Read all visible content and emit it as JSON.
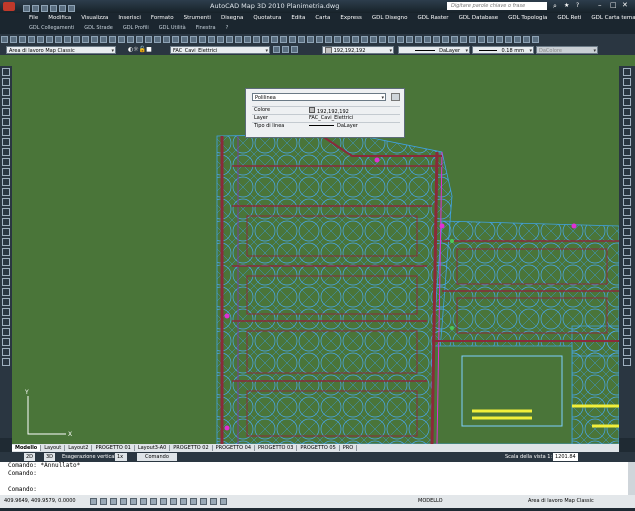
{
  "titlebar": {
    "title": "AutoCAD Map 3D 2010   Planimetria.dwg",
    "search_placeholder": "Digitare parole chiave o frase"
  },
  "menu": {
    "row1": [
      "File",
      "Modifica",
      "Visualizza",
      "Inserisci",
      "Formato",
      "Strumenti",
      "Disegna",
      "Quotatura",
      "Edita",
      "Carta",
      "Express",
      "GDL Disegno",
      "GDL Raster",
      "GDL Database",
      "GDL Topologia",
      "GDL Reti",
      "GDL Carta tematica"
    ],
    "row2": [
      "GDL Collegamenti",
      "GDL Strade",
      "GDL Profili",
      "GDL Utilità",
      "Finestra",
      "?"
    ]
  },
  "toolbar": {
    "workspace": "Area di lavoro Map Classic",
    "layer": "FAC_Cavi_Elettrici",
    "color": "192,192,192",
    "linetype": "DaLayer",
    "lineweight": "0.18 mm",
    "plotstyle": "DaColore"
  },
  "properties_palette": {
    "object_type": "Polilinea",
    "rows": [
      {
        "label": "Colore",
        "value": "192,192,192"
      },
      {
        "label": "Layer",
        "value": "FAC_Cavi_Elettrici"
      },
      {
        "label": "Tipo di linea",
        "value": "DaLayer"
      }
    ]
  },
  "tabs": [
    "Modello",
    "Layout",
    "Layout2",
    "PROGETTO 01",
    "Layout3-A0",
    "PROGETTO 02",
    "PROGETTO 04",
    "PROGETTO 03",
    "PROGETTO 05",
    "PRO"
  ],
  "status": {
    "mode2d": "2D",
    "mode3d": "3D",
    "exaggeration_label": "Esagerazione verticale:",
    "exaggeration_value": "1x",
    "command_label": "Comando",
    "scale_label": "Scala della vista 1:",
    "scale_value": "1201.84"
  },
  "command_lines": [
    "Comando: *Annullato*",
    "Comando:",
    "",
    "Comando:"
  ],
  "bottom": {
    "coords": "409.9649, 409.9579, 0.0000",
    "model": "MODELLO",
    "workspace": "Area di lavoro Map Classic"
  },
  "colors": {
    "canvas_bg": "#4a7539",
    "contour_blue": "#3fa3e6",
    "cable_red": "#8a2a3a",
    "highlight_yellow": "#f1ef3a",
    "magenta": "#e12fd6"
  }
}
